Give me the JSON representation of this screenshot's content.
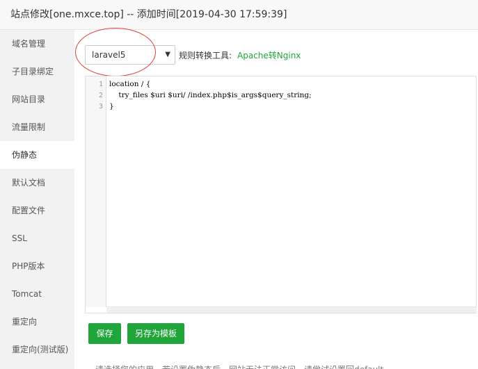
{
  "window": {
    "title": "站点修改[one.mxce.top] -- 添加时间[2019-04-30 17:59:39]"
  },
  "sidebar": {
    "items": [
      {
        "label": "域名管理"
      },
      {
        "label": "子目录绑定"
      },
      {
        "label": "网站目录"
      },
      {
        "label": "流量限制"
      },
      {
        "label": "伪静态",
        "active": true
      },
      {
        "label": "默认文档"
      },
      {
        "label": "配置文件"
      },
      {
        "label": "SSL"
      },
      {
        "label": "PHP版本"
      },
      {
        "label": "Tomcat"
      },
      {
        "label": "重定向"
      },
      {
        "label": "重定向(测试版)"
      }
    ]
  },
  "rewrite": {
    "selected_template": "laravel5",
    "rule_tool_label": "规则转换工具:",
    "rule_tool_link": "Apache转Nginx"
  },
  "editor": {
    "line_numbers": [
      "1",
      "2",
      "3"
    ],
    "lines": [
      "location / {",
      "    try_files $uri $uri/ /index.php$is_args$query_string;",
      "}"
    ]
  },
  "actions": {
    "save_label": "保存",
    "save_as_template_label": "另存为模板"
  },
  "hint": {
    "text": "请选择您的应用，若设置伪静态后，网站无法正常访问，请尝试设置回default"
  },
  "colors": {
    "accent": "#20a53a",
    "highlight_circle": "#e0423a"
  }
}
